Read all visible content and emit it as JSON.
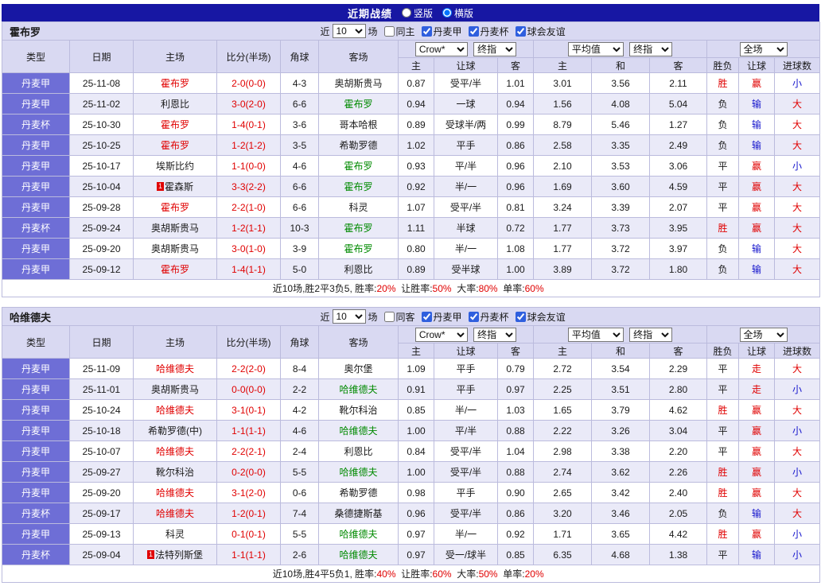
{
  "topbar": {
    "title": "近期战绩",
    "layouts": [
      {
        "label": "竖版",
        "selected": false
      },
      {
        "label": "横版",
        "selected": true
      }
    ]
  },
  "labels": {
    "near": "近",
    "games": "场",
    "leagues": [
      "丹麦甲",
      "丹麦杯",
      "球会友谊"
    ]
  },
  "columns": {
    "league": "类型",
    "date": "日期",
    "home": "主场",
    "score": "比分(半场)",
    "corner": "角球",
    "away": "客场",
    "sub": [
      "主",
      "让球",
      "客",
      "主",
      "和",
      "客",
      "胜负",
      "让球",
      "进球数"
    ]
  },
  "dropdowns": {
    "source": "Crow*",
    "final": "终指",
    "average": "平均值",
    "final2": "终指",
    "full": "全场"
  },
  "colors": {
    "topbar": "#1717A3",
    "header_bg": "#D9D9F2",
    "league_cell_bg": "#6E6ED6",
    "alt_row_bg": "#EAEAF8",
    "red": "#E00000",
    "green": "#008A00",
    "blue": "#1414CC",
    "border": "#BBBBDD"
  },
  "tables": [
    {
      "team": "霍布罗",
      "filter": {
        "count": "10",
        "same": "同主",
        "same_checked": false,
        "league_checked": [
          true,
          true,
          true
        ]
      },
      "rows": [
        {
          "league": "丹麦甲",
          "date": "25-11-08",
          "home": "霍布罗",
          "home_c": "red",
          "score": "2-0(0-0)",
          "corner": "4-3",
          "away": "奥胡斯贵马",
          "away_c": "",
          "odds": [
            "0.87",
            "受平/半",
            "1.01",
            "3.01",
            "3.56",
            "2.11"
          ],
          "res": "胜",
          "res_c": "red",
          "asian": "赢",
          "asian_c": "red",
          "ou": "小",
          "ou_c": "blue"
        },
        {
          "league": "丹麦甲",
          "date": "25-11-02",
          "home": "利恩比",
          "home_c": "",
          "score": "3-0(2-0)",
          "corner": "6-6",
          "away": "霍布罗",
          "away_c": "green",
          "odds": [
            "0.94",
            "一球",
            "0.94",
            "1.56",
            "4.08",
            "5.04"
          ],
          "res": "负",
          "res_c": "",
          "asian": "输",
          "asian_c": "blue",
          "ou": "大",
          "ou_c": "red"
        },
        {
          "league": "丹麦杯",
          "date": "25-10-30",
          "home": "霍布罗",
          "home_c": "red",
          "score": "1-4(0-1)",
          "corner": "3-6",
          "away": "哥本哈根",
          "away_c": "",
          "odds": [
            "0.89",
            "受球半/两",
            "0.99",
            "8.79",
            "5.46",
            "1.27"
          ],
          "res": "负",
          "res_c": "",
          "asian": "输",
          "asian_c": "blue",
          "ou": "大",
          "ou_c": "red"
        },
        {
          "league": "丹麦甲",
          "date": "25-10-25",
          "home": "霍布罗",
          "home_c": "red",
          "score": "1-2(1-2)",
          "corner": "3-5",
          "away": "希勒罗德",
          "away_c": "",
          "odds": [
            "1.02",
            "平手",
            "0.86",
            "2.58",
            "3.35",
            "2.49"
          ],
          "res": "负",
          "res_c": "",
          "asian": "输",
          "asian_c": "blue",
          "ou": "大",
          "ou_c": "red"
        },
        {
          "league": "丹麦甲",
          "date": "25-10-17",
          "home": "埃斯比约",
          "home_c": "",
          "score": "1-1(0-0)",
          "corner": "4-6",
          "away": "霍布罗",
          "away_c": "green",
          "odds": [
            "0.93",
            "平/半",
            "0.96",
            "2.10",
            "3.53",
            "3.06"
          ],
          "res": "平",
          "res_c": "",
          "asian": "赢",
          "asian_c": "red",
          "ou": "小",
          "ou_c": "blue"
        },
        {
          "league": "丹麦甲",
          "date": "25-10-04",
          "home": "霍森斯",
          "home_c": "",
          "home_badge": "1",
          "score": "3-3(2-2)",
          "corner": "6-6",
          "away": "霍布罗",
          "away_c": "green",
          "odds": [
            "0.92",
            "半/一",
            "0.96",
            "1.69",
            "3.60",
            "4.59"
          ],
          "res": "平",
          "res_c": "",
          "asian": "赢",
          "asian_c": "red",
          "ou": "大",
          "ou_c": "red"
        },
        {
          "league": "丹麦甲",
          "date": "25-09-28",
          "home": "霍布罗",
          "home_c": "red",
          "score": "2-2(1-0)",
          "corner": "6-6",
          "away": "科灵",
          "away_c": "",
          "odds": [
            "1.07",
            "受平/半",
            "0.81",
            "3.24",
            "3.39",
            "2.07"
          ],
          "res": "平",
          "res_c": "",
          "asian": "赢",
          "asian_c": "red",
          "ou": "大",
          "ou_c": "red"
        },
        {
          "league": "丹麦杯",
          "date": "25-09-24",
          "home": "奥胡斯贵马",
          "home_c": "",
          "score": "1-2(1-1)",
          "corner": "10-3",
          "away": "霍布罗",
          "away_c": "green",
          "odds": [
            "1.11",
            "半球",
            "0.72",
            "1.77",
            "3.73",
            "3.95"
          ],
          "res": "胜",
          "res_c": "red",
          "asian": "赢",
          "asian_c": "red",
          "ou": "大",
          "ou_c": "red"
        },
        {
          "league": "丹麦甲",
          "date": "25-09-20",
          "home": "奥胡斯贵马",
          "home_c": "",
          "score": "3-0(1-0)",
          "corner": "3-9",
          "away": "霍布罗",
          "away_c": "green",
          "odds": [
            "0.80",
            "半/一",
            "1.08",
            "1.77",
            "3.72",
            "3.97"
          ],
          "res": "负",
          "res_c": "",
          "asian": "输",
          "asian_c": "blue",
          "ou": "大",
          "ou_c": "red"
        },
        {
          "league": "丹麦甲",
          "date": "25-09-12",
          "home": "霍布罗",
          "home_c": "red",
          "score": "1-4(1-1)",
          "corner": "5-0",
          "away": "利恩比",
          "away_c": "",
          "odds": [
            "0.89",
            "受半球",
            "1.00",
            "3.89",
            "3.72",
            "1.80"
          ],
          "res": "负",
          "res_c": "",
          "asian": "输",
          "asian_c": "blue",
          "ou": "大",
          "ou_c": "red"
        }
      ],
      "summary": {
        "prefix": "近10场,胜2平3负5,",
        "stats": [
          [
            "胜率:",
            "20%"
          ],
          [
            "让胜率:",
            "50%"
          ],
          [
            "大率:",
            "80%"
          ],
          [
            "单率:",
            "60%"
          ]
        ]
      }
    },
    {
      "team": "哈维德夫",
      "filter": {
        "count": "10",
        "same": "同客",
        "same_checked": false,
        "league_checked": [
          true,
          true,
          true
        ]
      },
      "rows": [
        {
          "league": "丹麦甲",
          "date": "25-11-09",
          "home": "哈维德夫",
          "home_c": "red",
          "score": "2-2(2-0)",
          "corner": "8-4",
          "away": "奥尔堡",
          "away_c": "",
          "odds": [
            "1.09",
            "平手",
            "0.79",
            "2.72",
            "3.54",
            "2.29"
          ],
          "res": "平",
          "res_c": "",
          "asian": "走",
          "asian_c": "red",
          "ou": "大",
          "ou_c": "red"
        },
        {
          "league": "丹麦甲",
          "date": "25-11-01",
          "home": "奥胡斯贵马",
          "home_c": "",
          "score": "0-0(0-0)",
          "corner": "2-2",
          "away": "哈维德夫",
          "away_c": "green",
          "odds": [
            "0.91",
            "平手",
            "0.97",
            "2.25",
            "3.51",
            "2.80"
          ],
          "res": "平",
          "res_c": "",
          "asian": "走",
          "asian_c": "red",
          "ou": "小",
          "ou_c": "blue"
        },
        {
          "league": "丹麦甲",
          "date": "25-10-24",
          "home": "哈维德夫",
          "home_c": "red",
          "score": "3-1(0-1)",
          "corner": "4-2",
          "away": "靴尔科治",
          "away_c": "",
          "odds": [
            "0.85",
            "半/一",
            "1.03",
            "1.65",
            "3.79",
            "4.62"
          ],
          "res": "胜",
          "res_c": "red",
          "asian": "赢",
          "asian_c": "red",
          "ou": "大",
          "ou_c": "red"
        },
        {
          "league": "丹麦甲",
          "date": "25-10-18",
          "home": "希勒罗德(中)",
          "home_c": "",
          "score": "1-1(1-1)",
          "corner": "4-6",
          "away": "哈维德夫",
          "away_c": "green",
          "odds": [
            "1.00",
            "平/半",
            "0.88",
            "2.22",
            "3.26",
            "3.04"
          ],
          "res": "平",
          "res_c": "",
          "asian": "赢",
          "asian_c": "red",
          "ou": "小",
          "ou_c": "blue"
        },
        {
          "league": "丹麦甲",
          "date": "25-10-07",
          "home": "哈维德夫",
          "home_c": "red",
          "score": "2-2(2-1)",
          "corner": "2-4",
          "away": "利恩比",
          "away_c": "",
          "odds": [
            "0.84",
            "受平/半",
            "1.04",
            "2.98",
            "3.38",
            "2.20"
          ],
          "res": "平",
          "res_c": "",
          "asian": "赢",
          "asian_c": "red",
          "ou": "大",
          "ou_c": "red"
        },
        {
          "league": "丹麦甲",
          "date": "25-09-27",
          "home": "靴尔科治",
          "home_c": "",
          "score": "0-2(0-0)",
          "corner": "5-5",
          "away": "哈维德夫",
          "away_c": "green",
          "odds": [
            "1.00",
            "受平/半",
            "0.88",
            "2.74",
            "3.62",
            "2.26"
          ],
          "res": "胜",
          "res_c": "red",
          "asian": "赢",
          "asian_c": "red",
          "ou": "小",
          "ou_c": "blue"
        },
        {
          "league": "丹麦甲",
          "date": "25-09-20",
          "home": "哈维德夫",
          "home_c": "red",
          "score": "3-1(2-0)",
          "corner": "0-6",
          "away": "希勒罗德",
          "away_c": "",
          "odds": [
            "0.98",
            "平手",
            "0.90",
            "2.65",
            "3.42",
            "2.40"
          ],
          "res": "胜",
          "res_c": "red",
          "asian": "赢",
          "asian_c": "red",
          "ou": "大",
          "ou_c": "red"
        },
        {
          "league": "丹麦杯",
          "date": "25-09-17",
          "home": "哈维德夫",
          "home_c": "red",
          "score": "1-2(0-1)",
          "corner": "7-4",
          "away": "桑德捷斯基",
          "away_c": "",
          "odds": [
            "0.96",
            "受平/半",
            "0.86",
            "3.20",
            "3.46",
            "2.05"
          ],
          "res": "负",
          "res_c": "",
          "asian": "输",
          "asian_c": "blue",
          "ou": "大",
          "ou_c": "red"
        },
        {
          "league": "丹麦甲",
          "date": "25-09-13",
          "home": "科灵",
          "home_c": "",
          "score": "0-1(0-1)",
          "corner": "5-5",
          "away": "哈维德夫",
          "away_c": "green",
          "odds": [
            "0.97",
            "半/一",
            "0.92",
            "1.71",
            "3.65",
            "4.42"
          ],
          "res": "胜",
          "res_c": "red",
          "asian": "赢",
          "asian_c": "red",
          "ou": "小",
          "ou_c": "blue"
        },
        {
          "league": "丹麦杯",
          "date": "25-09-04",
          "home": "法特列斯堡",
          "home_c": "",
          "home_badge": "1",
          "score": "1-1(1-1)",
          "corner": "2-6",
          "away": "哈维德夫",
          "away_c": "green",
          "odds": [
            "0.97",
            "受一/球半",
            "0.85",
            "6.35",
            "4.68",
            "1.38"
          ],
          "res": "平",
          "res_c": "",
          "asian": "输",
          "asian_c": "blue",
          "ou": "小",
          "ou_c": "blue"
        }
      ],
      "summary": {
        "prefix": "近10场,胜4平5负1,",
        "stats": [
          [
            "胜率:",
            "40%"
          ],
          [
            "让胜率:",
            "60%"
          ],
          [
            "大率:",
            "50%"
          ],
          [
            "单率:",
            "20%"
          ]
        ]
      }
    }
  ]
}
